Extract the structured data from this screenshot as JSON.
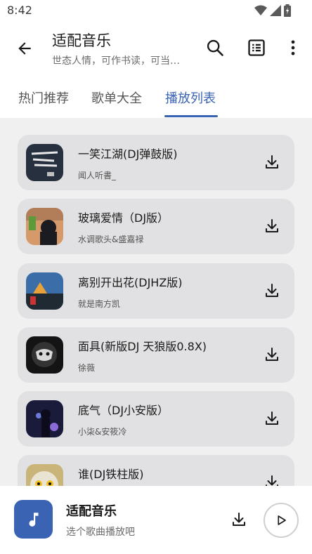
{
  "status_bar": {
    "time": "8:42",
    "icons": [
      "wifi-icon",
      "signal-icon",
      "battery-icon"
    ]
  },
  "app_bar": {
    "title": "适配音乐",
    "subtitle": "世态人情，可作书读，可当…",
    "actions": [
      "search-icon",
      "list-icon",
      "more-vert-icon"
    ]
  },
  "tabs": [
    {
      "label": "热门推荐",
      "active": false
    },
    {
      "label": "歌单大全",
      "active": false
    },
    {
      "label": "播放列表",
      "active": true
    }
  ],
  "songs": [
    {
      "title": "一笑江湖(DJ弹鼓版)",
      "artist": "闻人听書_"
    },
    {
      "title": "玻璃爱情（DJ版）",
      "artist": "水调歌头&盛嘉禄"
    },
    {
      "title": "离别开出花(DJHZ版)",
      "artist": "就是南方凯"
    },
    {
      "title": "面具(新版DJ 天狼版0.8X)",
      "artist": "徐薇"
    },
    {
      "title": "底气（DJ小安版）",
      "artist": "小柒&安筱冷"
    },
    {
      "title": "谁(DJ铁柱版)",
      "artist": ""
    }
  ],
  "player": {
    "title": "适配音乐",
    "subtitle": "选个歌曲播放吧"
  },
  "colors": {
    "accent": "#3a63b4",
    "card": "#e1e1e3",
    "background": "#f0f0f0"
  }
}
